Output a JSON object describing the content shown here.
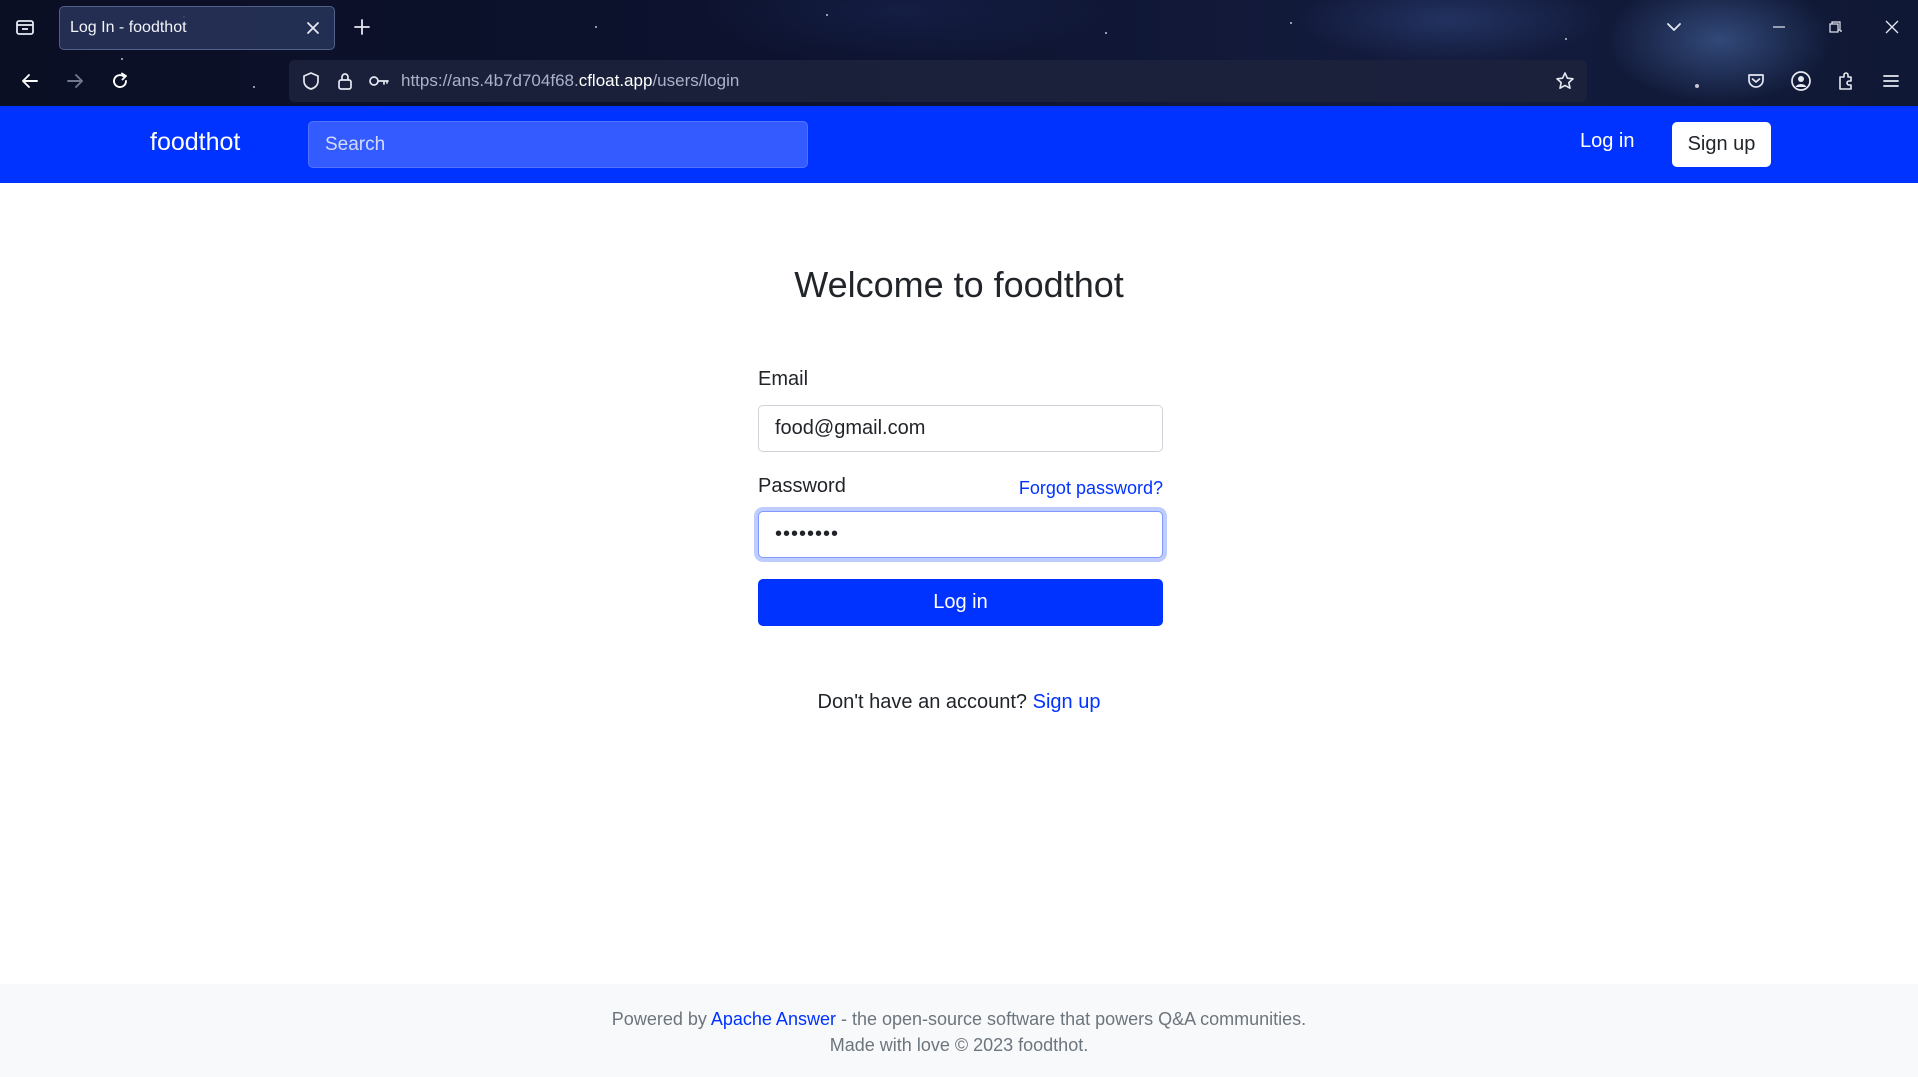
{
  "browser": {
    "tab_title": "Log In - foodthot",
    "url_prefix": "https://ans.4b7d704f68.",
    "url_host": "cfloat.app",
    "url_path": "/users/login"
  },
  "header": {
    "brand": "foodthot",
    "search_placeholder": "Search",
    "login_label": "Log in",
    "signup_label": "Sign up",
    "bar_color": "#0033ff"
  },
  "main": {
    "title": "Welcome to foodthot",
    "email_label": "Email",
    "email_value": "food@gmail.com",
    "password_label": "Password",
    "password_value": "password",
    "forgot_label": "Forgot password?",
    "login_button": "Log in",
    "no_account_text": "Don't have an account?",
    "signup_link": "Sign up"
  },
  "footer": {
    "powered_by": "Powered by",
    "apache_link": "Apache Answer",
    "powered_suffix": "- the open-source software that powers Q&A communities.",
    "made_with": "Made with love © 2023 foodthot."
  },
  "icons": {
    "tab_list": "tab-list-icon",
    "close": "close-icon",
    "new_tab": "plus-icon",
    "back": "back-arrow-icon",
    "forward": "forward-arrow-icon",
    "reload": "reload-icon",
    "shield": "shield-icon",
    "lock": "lock-icon",
    "key": "key-icon",
    "bookmark": "star-icon",
    "pocket": "pocket-icon",
    "account": "account-icon",
    "extensions": "puzzle-icon",
    "menu": "hamburger-menu-icon"
  }
}
